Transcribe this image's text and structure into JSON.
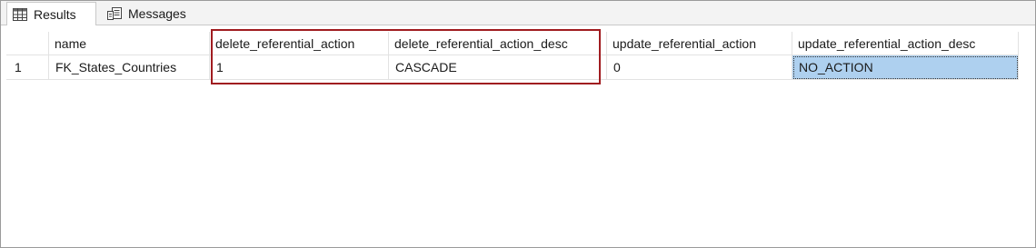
{
  "tabs": [
    {
      "label": "Results",
      "icon": "grid-icon"
    },
    {
      "label": "Messages",
      "icon": "messages-icon"
    }
  ],
  "grid": {
    "columns": [
      "",
      "name",
      "delete_referential_action",
      "delete_referential_action_desc",
      "update_referential_action",
      "update_referential_action_desc"
    ],
    "rows": [
      {
        "num": "1",
        "cells": [
          "FK_States_Countries",
          "1",
          "CASCADE",
          "0",
          "NO_ACTION"
        ]
      }
    ]
  },
  "highlight_color": "#a01c20",
  "selection_color": "#aed0ef"
}
